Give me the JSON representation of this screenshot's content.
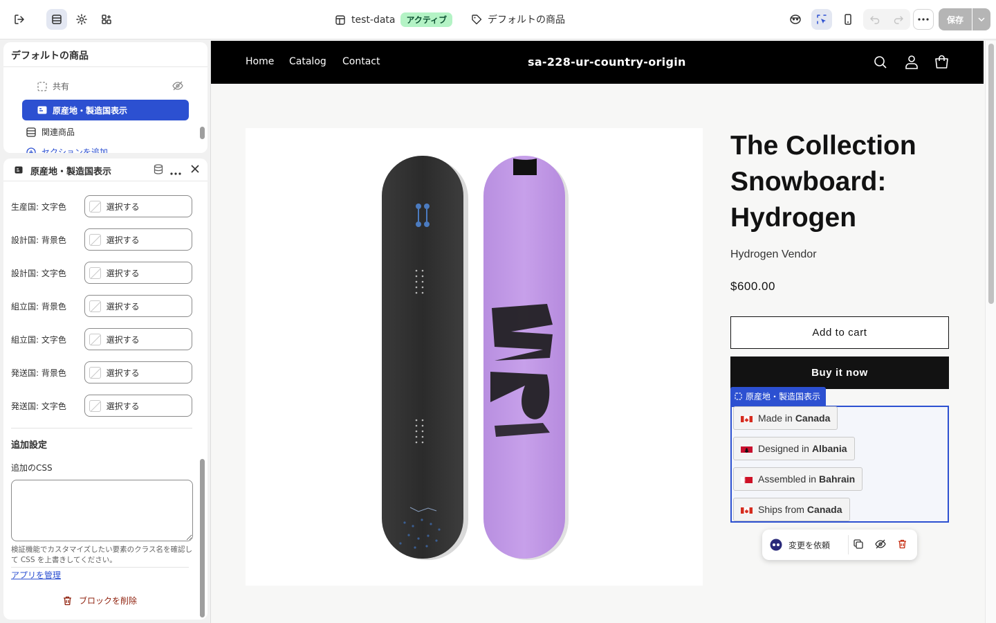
{
  "topbar": {
    "store_label": "test-data",
    "status_badge": "アクティブ",
    "template_label": "デフォルトの商品",
    "save_label": "保存"
  },
  "section_panel": {
    "title": "デフォルトの商品",
    "items": [
      {
        "label": "共有",
        "hidden": true
      },
      {
        "label": "原産地・製造国表示",
        "selected": true
      },
      {
        "label": "関連商品"
      },
      {
        "label": "セクションを追加"
      }
    ]
  },
  "block_panel": {
    "title": "原産地・製造国表示",
    "settings": [
      {
        "label": "生産国: 文字色",
        "value": "選択する"
      },
      {
        "label": "設計国: 背景色",
        "value": "選択する"
      },
      {
        "label": "設計国: 文字色",
        "value": "選択する"
      },
      {
        "label": "組立国: 背景色",
        "value": "選択する"
      },
      {
        "label": "組立国: 文字色",
        "value": "選択する"
      },
      {
        "label": "発送国: 背景色",
        "value": "選択する"
      },
      {
        "label": "発送国: 文字色",
        "value": "選択する"
      }
    ],
    "additional_heading": "追加設定",
    "css_label": "追加のCSS",
    "css_value": "",
    "css_help": "検証機能でカスタマイズしたい要素のクラス名を確認して CSS を上書きしてください。",
    "manage_link": "アプリを管理",
    "delete_label": "ブロックを削除"
  },
  "store": {
    "nav": [
      "Home",
      "Catalog",
      "Contact"
    ],
    "name": "sa-228-ur-country-origin",
    "product": {
      "title": "The Collection Snowboard: Hydrogen",
      "vendor": "Hydrogen Vendor",
      "price": "$600.00",
      "add_to_cart": "Add to cart",
      "buy_now": "Buy it now"
    },
    "block_tag": "原産地・製造国表示",
    "origins": [
      {
        "prefix": "Made in",
        "country": "Canada",
        "flag": "canada"
      },
      {
        "prefix": "Designed in",
        "country": "Albania",
        "flag": "albania"
      },
      {
        "prefix": "Assembled in",
        "country": "Bahrain",
        "flag": "bahrain"
      },
      {
        "prefix": "Ships from",
        "country": "Canada",
        "flag": "canada"
      }
    ],
    "floating_toolbar": {
      "request_label": "変更を依頼"
    }
  },
  "colors": {
    "accent": "#2c50d1",
    "badge_bg": "#b4f3c5",
    "store_nav_bg": "#000000"
  }
}
